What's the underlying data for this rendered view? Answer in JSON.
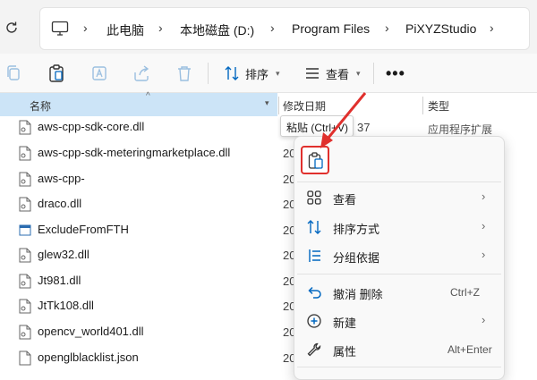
{
  "address_bar": {
    "breadcrumbs": [
      "此电脑",
      "本地磁盘 (D:)",
      "Program Files",
      "PiXYZStudio"
    ]
  },
  "toolbar": {
    "sort_label": "排序",
    "view_label": "查看",
    "more_label": "•••"
  },
  "columns": {
    "name": "名称",
    "date_modified": "修改日期",
    "type": "类型"
  },
  "files": [
    {
      "name": "aws-cpp-sdk-core.dll",
      "icon": "dll-file-icon"
    },
    {
      "name": "aws-cpp-sdk-meteringmarketplace.dll",
      "icon": "dll-file-icon"
    },
    {
      "name": "aws-cpp-",
      "icon": "dll-file-icon"
    },
    {
      "name": "draco.dll",
      "icon": "dll-file-icon"
    },
    {
      "name": "ExcludeFromFTH",
      "icon": "exe-file-icon"
    },
    {
      "name": "glew32.dll",
      "icon": "dll-file-icon"
    },
    {
      "name": "Jt981.dll",
      "icon": "dll-file-icon"
    },
    {
      "name": "JtTk108.dll",
      "icon": "dll-file-icon"
    },
    {
      "name": "opencv_world401.dll",
      "icon": "dll-file-icon"
    },
    {
      "name": "openglblacklist.json",
      "icon": "json-file-icon"
    }
  ],
  "date_fragments": [
    "37",
    "20",
    "20",
    "20",
    "20",
    "20",
    "20",
    "20",
    "20",
    "20"
  ],
  "type_fragment": "应用程序扩展",
  "tooltip": {
    "text": "粘贴 (Ctrl+V)"
  },
  "context_menu": {
    "items": [
      {
        "label": "查看",
        "shortcut": "",
        "has_submenu": true
      },
      {
        "label": "排序方式",
        "shortcut": "",
        "has_submenu": true
      },
      {
        "label": "分组依据",
        "shortcut": "",
        "has_submenu": true
      },
      {
        "label": "撤消 删除",
        "shortcut": "Ctrl+Z",
        "has_submenu": false
      },
      {
        "label": "新建",
        "shortcut": "",
        "has_submenu": true
      },
      {
        "label": "属性",
        "shortcut": "Alt+Enter",
        "has_submenu": false
      }
    ]
  },
  "colors": {
    "accent": "#0067c0",
    "highlight": "#e0302d",
    "selected_header": "#cce4f7"
  }
}
